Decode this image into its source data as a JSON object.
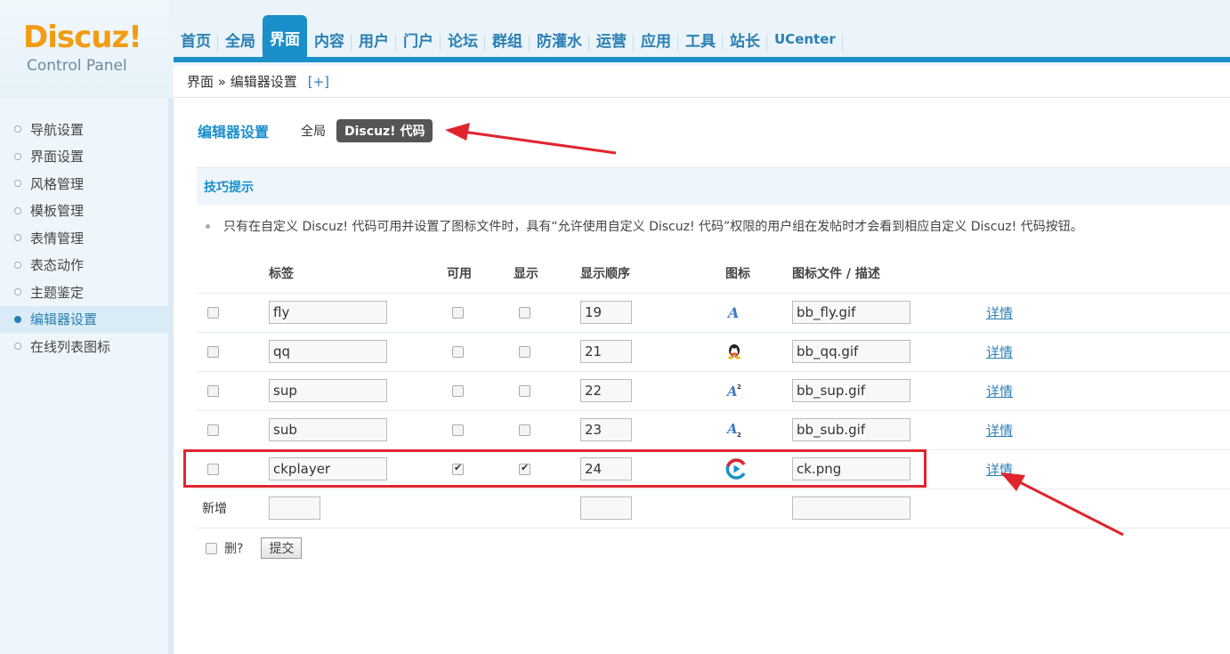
{
  "logo": {
    "brand": "Discuz!",
    "subtitle": "Control Panel"
  },
  "topnav": [
    {
      "label": "首页"
    },
    {
      "label": "全局"
    },
    {
      "label": "界面",
      "active": true
    },
    {
      "label": "内容"
    },
    {
      "label": "用户"
    },
    {
      "label": "门户"
    },
    {
      "label": "论坛"
    },
    {
      "label": "群组"
    },
    {
      "label": "防灌水"
    },
    {
      "label": "运营"
    },
    {
      "label": "应用"
    },
    {
      "label": "工具"
    },
    {
      "label": "站长"
    },
    {
      "label": "UCenter"
    }
  ],
  "breadcrumb": {
    "path": "界面 » 编辑器设置",
    "add": "[+]"
  },
  "sidebar": [
    {
      "label": "导航设置"
    },
    {
      "label": "界面设置"
    },
    {
      "label": "风格管理"
    },
    {
      "label": "模板管理"
    },
    {
      "label": "表情管理"
    },
    {
      "label": "表态动作"
    },
    {
      "label": "主题鉴定"
    },
    {
      "label": "编辑器设置",
      "active": true
    },
    {
      "label": "在线列表图标"
    }
  ],
  "page": {
    "title": "编辑器设置",
    "tab_global": "全局",
    "tab_code": "Discuz! 代码"
  },
  "tips": {
    "heading": "技巧提示",
    "text": "只有在自定义 Discuz! 代码可用并设置了图标文件时，具有“允许使用自定义 Discuz! 代码”权限的用户组在发帖时才会看到相应自定义 Discuz! 代码按钮。"
  },
  "table": {
    "headers": {
      "tag": "标签",
      "available": "可用",
      "show": "显示",
      "order": "显示顺序",
      "icon": "图标",
      "file": "图标文件 / 描述"
    },
    "rows": [
      {
        "tag": "fly",
        "available": false,
        "show": false,
        "order": "19",
        "icon": "fly-icon",
        "file": "bb_fly.gif",
        "detail": "详情"
      },
      {
        "tag": "qq",
        "available": false,
        "show": false,
        "order": "21",
        "icon": "qq-icon",
        "file": "bb_qq.gif",
        "detail": "详情"
      },
      {
        "tag": "sup",
        "available": false,
        "show": false,
        "order": "22",
        "icon": "sup-icon",
        "file": "bb_sup.gif",
        "detail": "详情"
      },
      {
        "tag": "sub",
        "available": false,
        "show": false,
        "order": "23",
        "icon": "sub-icon",
        "file": "bb_sub.gif",
        "detail": "详情"
      },
      {
        "tag": "ckplayer",
        "available": true,
        "show": true,
        "order": "24",
        "icon": "ckplayer-icon",
        "file": "ck.png",
        "detail": "详情"
      }
    ],
    "new_label": "新增"
  },
  "footer": {
    "delete_label": "删?",
    "submit_label": "提交"
  },
  "colors": {
    "accent": "#1a8fca",
    "highlight": "#e0242e",
    "logo": "#f39c12"
  }
}
